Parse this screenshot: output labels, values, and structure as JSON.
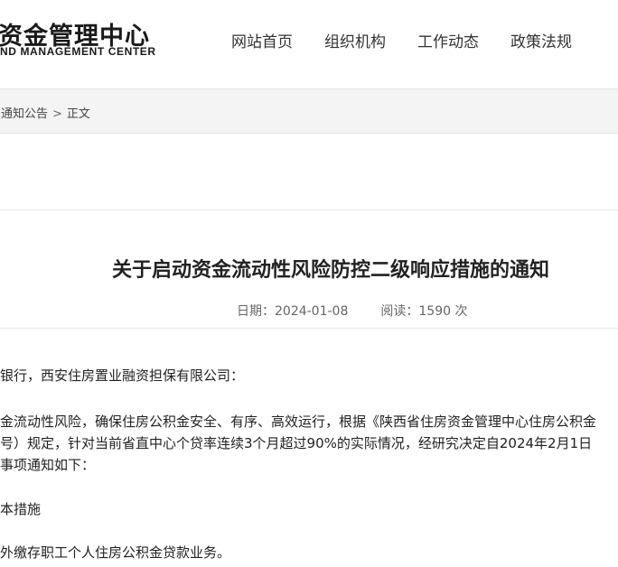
{
  "header": {
    "logo_cn": "资金管理中心",
    "logo_en": "ND MANAGEMENT CENTER",
    "nav": [
      {
        "label": "网站首页"
      },
      {
        "label": "组织机构"
      },
      {
        "label": "工作动态"
      },
      {
        "label": "政策法规"
      }
    ]
  },
  "breadcrumb": {
    "section": "通知公告",
    "separator": ">",
    "current": "正文"
  },
  "article": {
    "title": "关于启动资金流动性风险防控二级响应措施的通知",
    "date_label": "日期：2024-01-08",
    "views_label": "阅读：1590 次",
    "paragraphs": [
      "银行，西安住房置业融资担保有限公司：",
      "金流动性风险，确保住房公积金安全、有序、高效运行，根据《陕西省住房资金管理中心住房公积金",
      "号）规定，针对当前省直中心个贷率连续3个月超过90%的实际情况，经研究决定自2024年2月1日",
      "事项通知如下：",
      "本措施",
      "外缴存职工个人住房公积金贷款业务。"
    ]
  }
}
